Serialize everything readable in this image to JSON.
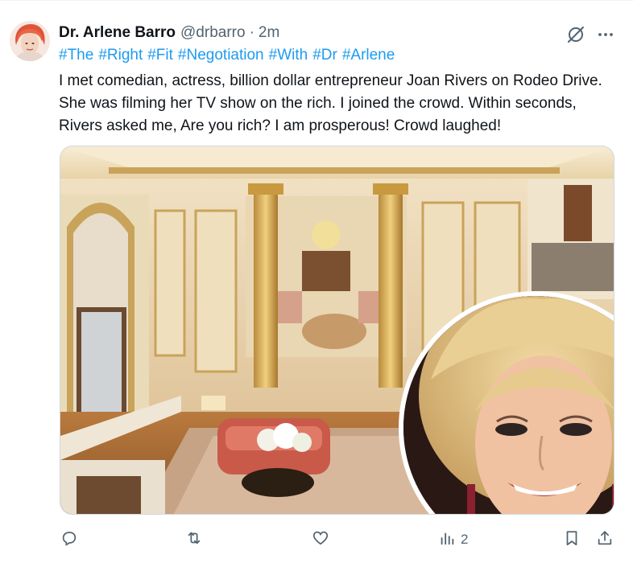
{
  "tweet": {
    "author_name": "Dr. Arlene Barro",
    "handle": "@drbarro",
    "separator": "·",
    "time": "2m",
    "hashtags": [
      "#The",
      "#Right",
      "#Fit",
      "#Negotiation",
      "#With",
      "#Dr",
      "#Arlene"
    ],
    "text": "I met comedian, actress, billion dollar entrepreneur Joan Rivers on Rodeo Drive. She was filming her TV show on the rich. I joined the crowd. Within seconds, Rivers asked me, Are you rich? I am prosperous! Crowd laughed!"
  },
  "actions": {
    "reply_icon": "reply-icon",
    "retweet_icon": "retweet-icon",
    "like_icon": "heart-icon",
    "views_icon": "views-icon",
    "views_count": "2",
    "bookmark_icon": "bookmark-icon",
    "share_icon": "share-icon"
  },
  "colors": {
    "link": "#1d9bf0",
    "secondary": "#536471",
    "primary_text": "#0f1419"
  }
}
